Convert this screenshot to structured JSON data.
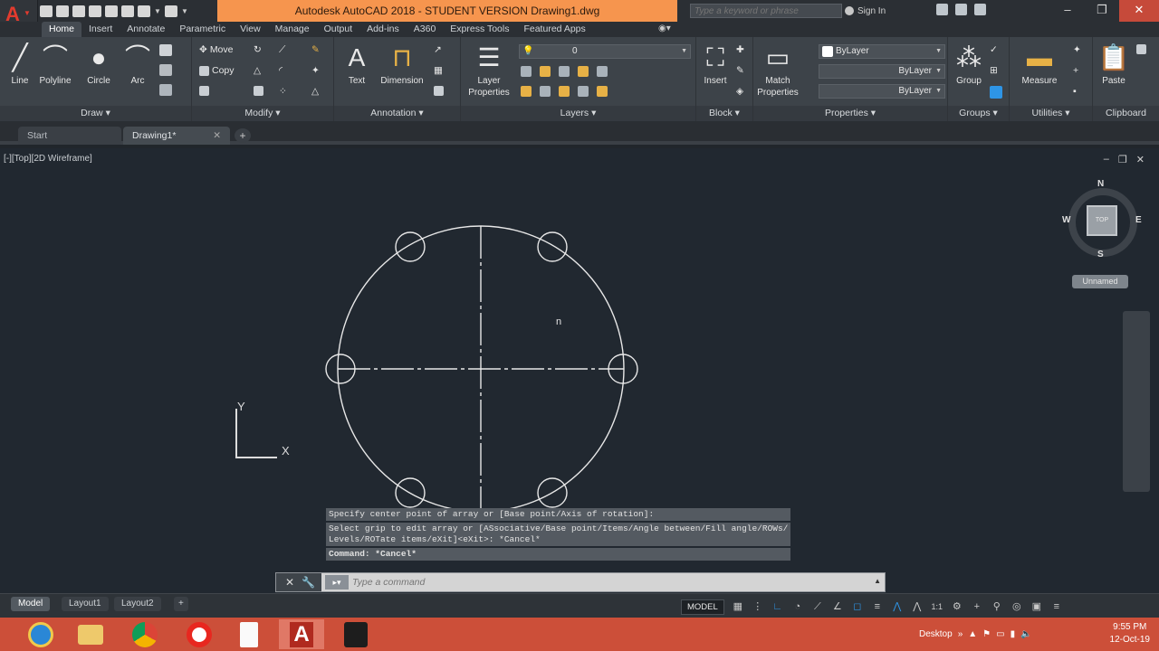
{
  "window": {
    "title": "Autodesk AutoCAD 2018 - STUDENT VERSION    Drawing1.dwg",
    "search_placeholder": "Type a keyword or phrase",
    "signin": "Sign In",
    "app_letter": "A"
  },
  "ribbon_tabs": [
    "Home",
    "Insert",
    "Annotate",
    "Parametric",
    "View",
    "Manage",
    "Output",
    "Add-ins",
    "A360",
    "Express Tools",
    "Featured Apps"
  ],
  "panels": {
    "draw": {
      "title": "Draw",
      "line": "Line",
      "polyline": "Polyline",
      "circle": "Circle",
      "arc": "Arc"
    },
    "modify": {
      "title": "Modify",
      "move": "Move",
      "copy": "Copy"
    },
    "annotation": {
      "title": "Annotation",
      "text": "Text",
      "dimension": "Dimension"
    },
    "layers": {
      "title": "Layers",
      "layer_properties_1": "Layer",
      "layer_properties_2": "Properties",
      "current_layer": "0"
    },
    "block": {
      "title": "Block",
      "insert": "Insert"
    },
    "properties": {
      "title": "Properties",
      "match_1": "Match",
      "match_2": "Properties",
      "color": "ByLayer",
      "linetype": "ByLayer",
      "lineweight": "ByLayer"
    },
    "groups": {
      "title": "Groups",
      "group": "Group"
    },
    "utilities": {
      "title": "Utilities",
      "measure": "Measure"
    },
    "clipboard": {
      "title": "Clipboard",
      "paste": "Paste"
    }
  },
  "doc_tabs": [
    "Start",
    "Drawing1*"
  ],
  "viewport": {
    "label": "[-][Top][2D Wireframe]",
    "viewcube": {
      "n": "N",
      "s": "S",
      "e": "E",
      "w": "W",
      "face": "TOP"
    },
    "wcs": "Unnamed",
    "ucs_x": "X",
    "ucs_y": "Y",
    "cursor_glyph": "n"
  },
  "command": {
    "history": [
      "Specify center point of array or [Base point/Axis of rotation]:",
      "Select grip to edit array or [ASsociative/Base point/Items/Angle between/Fill angle/ROWs/\nLevels/ROTate items/eXit]<eXit>: *Cancel*",
      "Command: *Cancel*"
    ],
    "placeholder": "Type a command"
  },
  "layout_tabs": [
    "Model",
    "Layout1",
    "Layout2"
  ],
  "status": {
    "model": "MODEL",
    "scale": "1:1"
  },
  "taskbar": {
    "desktop": "Desktop",
    "time": "9:55 PM",
    "date": "12-Oct-19"
  },
  "colors": {
    "accent_orange": "#f6954e",
    "taskbar": "#cc4f39",
    "canvas": "#212830"
  }
}
